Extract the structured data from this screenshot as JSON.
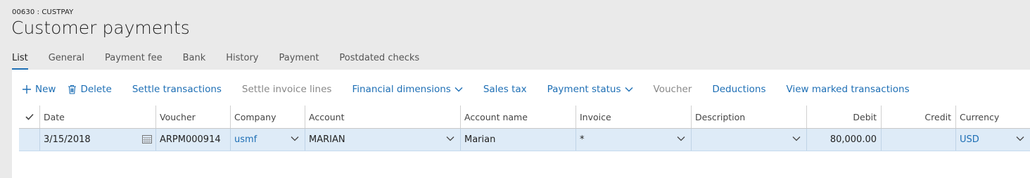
{
  "caption": "00630 : CUSTPAY",
  "title": "Customer payments",
  "tabs": [
    {
      "label": "List",
      "active": true
    },
    {
      "label": "General"
    },
    {
      "label": "Payment fee"
    },
    {
      "label": "Bank"
    },
    {
      "label": "History"
    },
    {
      "label": "Payment"
    },
    {
      "label": "Postdated checks"
    }
  ],
  "actions": {
    "new": "New",
    "delete": "Delete",
    "settle_transactions": "Settle transactions",
    "settle_invoice_lines": "Settle invoice lines",
    "financial_dimensions": "Financial dimensions",
    "sales_tax": "Sales tax",
    "payment_status": "Payment status",
    "voucher": "Voucher",
    "deductions": "Deductions",
    "view_marked": "View marked transactions"
  },
  "grid": {
    "columns": {
      "date": "Date",
      "voucher": "Voucher",
      "company": "Company",
      "account": "Account",
      "account_name": "Account name",
      "invoice": "Invoice",
      "description": "Description",
      "debit": "Debit",
      "credit": "Credit",
      "currency": "Currency"
    },
    "rows": [
      {
        "date": "3/15/2018",
        "voucher": "ARPM000914",
        "company": "usmf",
        "account": "MARIAN",
        "account_name": "Marian",
        "invoice": "*",
        "description": "",
        "debit": "80,000.00",
        "credit": "",
        "currency": "USD"
      }
    ]
  },
  "colors": {
    "accent": "#1e6fb5",
    "row_selected": "#deebf7",
    "page_bg": "#eaeaea"
  }
}
